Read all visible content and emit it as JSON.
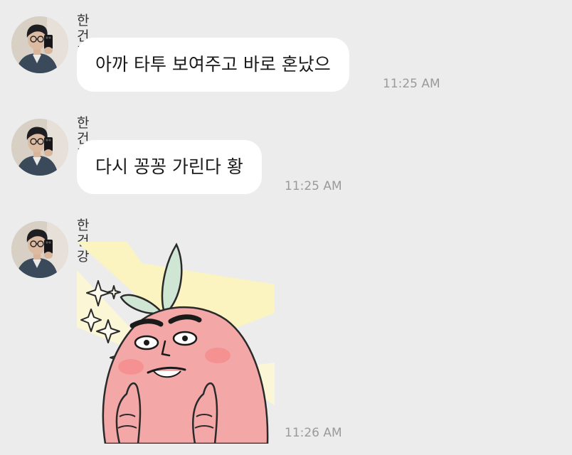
{
  "messages": [
    {
      "sender": "한건강",
      "text": "아까 타투 보여주고 바로 혼났으",
      "time": "11:25 AM",
      "type": "text"
    },
    {
      "sender": "한건강",
      "text": "다시 꽁꽁 가린다 황",
      "time": "11:25 AM",
      "type": "text"
    },
    {
      "sender": "한건강",
      "sticker": "peach-character-thumbs-up-sticker",
      "time": "11:26 AM",
      "type": "sticker"
    }
  ],
  "colors": {
    "background": "#ececec",
    "bubble": "#ffffff",
    "time_text": "#9a9a9a",
    "sticker_peach": "#f4a7a7",
    "sticker_leaf": "#cfe6d4",
    "sticker_rays": "#fbf3c0"
  }
}
